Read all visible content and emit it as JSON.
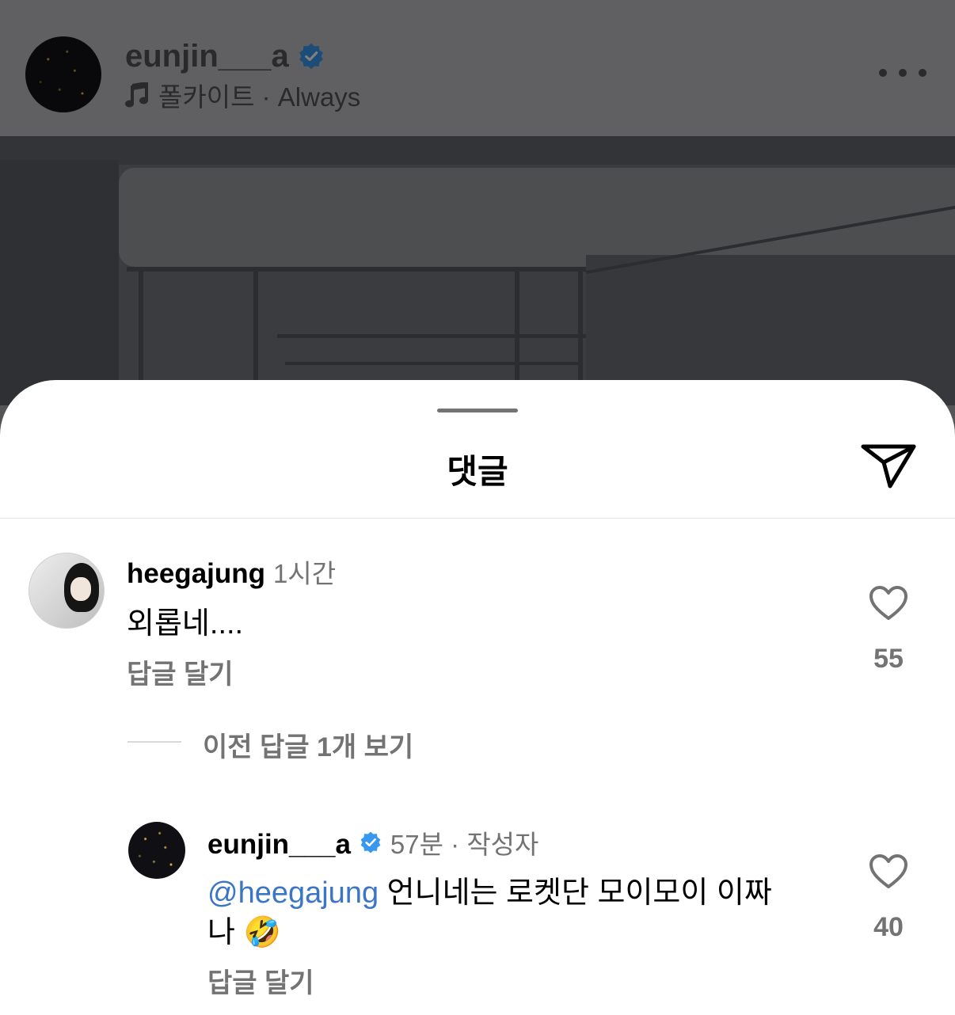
{
  "post": {
    "username": "eunjin___a",
    "music_icon": "music-note-icon",
    "music_text": "폴카이트 · Always"
  },
  "sheet": {
    "title": "댓글",
    "comments": [
      {
        "username": "heegajung",
        "time": "1시간",
        "text": "외롭네....",
        "reply_label": "답글 달기",
        "likes": "55"
      }
    ],
    "view_previous": "이전 답글 1개 보기",
    "reply": {
      "username": "eunjin___a",
      "meta": "57분 · 작성자",
      "mention": "@heegajung",
      "text_line1": "언니네는 로켓단 모이모이 이짜",
      "text_line2": "나 🤣",
      "reply_label": "답글 달기",
      "likes": "40"
    }
  },
  "colors": {
    "accent_blue": "#3b76c6",
    "verified_blue": "#3897f0",
    "muted": "#737373"
  }
}
